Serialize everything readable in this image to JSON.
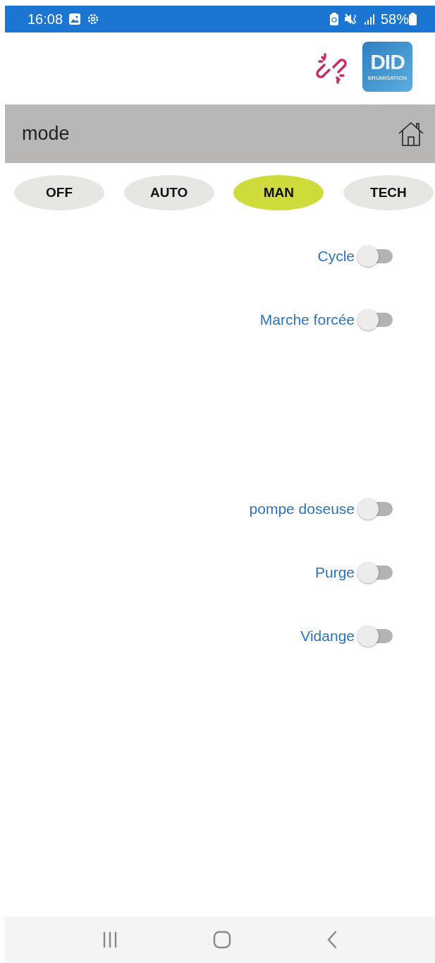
{
  "status_bar": {
    "time": "16:08",
    "battery": "58%"
  },
  "header": {
    "logo": {
      "title": "DID",
      "subtitle": "BRUMISATION"
    },
    "connected": false
  },
  "title_bar": {
    "title": "mode"
  },
  "modes": [
    {
      "label": "OFF",
      "selected": false
    },
    {
      "label": "AUTO",
      "selected": false
    },
    {
      "label": "MAN",
      "selected": true
    },
    {
      "label": "TECH",
      "selected": false
    }
  ],
  "switch_groups": [
    [
      {
        "label": "Cycle",
        "on": false
      },
      {
        "label": "Marche forcée",
        "on": false
      }
    ],
    [
      {
        "label": "pompe doseuse",
        "on": false
      },
      {
        "label": "Purge",
        "on": false
      },
      {
        "label": "Vidange",
        "on": false
      }
    ]
  ]
}
